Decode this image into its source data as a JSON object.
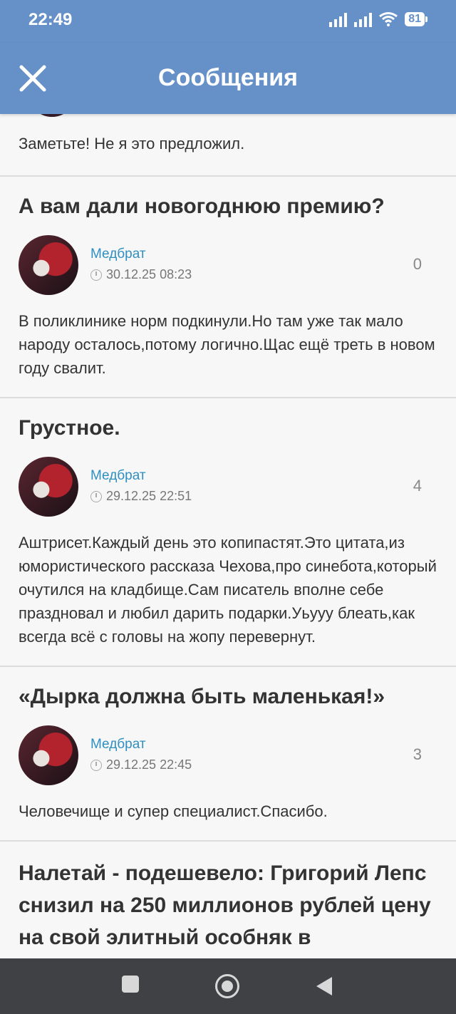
{
  "status_bar": {
    "time": "22:49",
    "battery": "81"
  },
  "app_bar": {
    "title": "Сообщения"
  },
  "feed": {
    "previous_post_text": "Заметьте! Не я это предложил.",
    "posts": [
      {
        "title": "А вам дали новогоднюю премию?",
        "author": "Медбрат",
        "date": "30.12.25 08:23",
        "comments": "0",
        "text": "В поликлинике норм подкинули.Но там уже так мало народу осталось,потому логично.Щас ещё треть в новом году свалит."
      },
      {
        "title": "Грустное.",
        "author": "Медбрат",
        "date": "29.12.25 22:51",
        "comments": "4",
        "text": "Аштрисет.Каждый день это копипастят.Это цитата,из юмористического рассказа Чехова,про синебота,который очутился на кладбище.Сам писатель вполне себе праздновал и любил дарить подарки.Уьууу блеать,как всегда всё с головы на жопу перевернут."
      },
      {
        "title": "«Дырка должна быть маленькая!»",
        "author": "Медбрат",
        "date": "29.12.25 22:45",
        "comments": "3",
        "text": "Человечище и супер специалист.Спасибо."
      },
      {
        "title": "Налетай - подешевело: Григорий Лепс снизил на 250 миллионов рублей цену на свой элитный особняк в"
      }
    ]
  },
  "icons": {
    "close": "close-icon",
    "clock": "clock-icon",
    "nav_recents": "square-icon",
    "nav_home": "circle-icon",
    "nav_back": "triangle-back-icon"
  },
  "colors": {
    "header": "#6591c8",
    "author": "#2f8fc1",
    "navbar": "#3f4145"
  }
}
